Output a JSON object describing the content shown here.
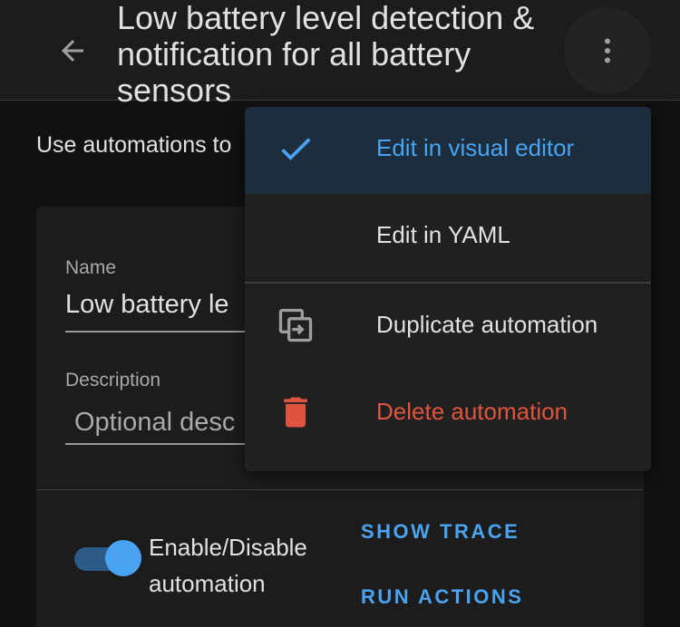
{
  "header": {
    "title": "Low battery level detection & notification for all battery sensors"
  },
  "intro_text": "Use automations to",
  "form": {
    "name_label": "Name",
    "name_value": "Low battery le",
    "description_label": "Description",
    "description_placeholder": "Optional desc"
  },
  "toggle": {
    "label": "Enable/Disable automation",
    "enabled": true
  },
  "actions": {
    "show_trace": "SHOW TRACE",
    "run_actions": "RUN ACTIONS"
  },
  "menu": {
    "items": [
      {
        "label": "Edit in visual editor",
        "icon": "check-icon",
        "selected": true,
        "color": "#4aa3f0"
      },
      {
        "label": "Edit in YAML",
        "icon": "",
        "selected": false,
        "color": "#e1e1e1"
      },
      {
        "label": "Duplicate automation",
        "icon": "duplicate-icon",
        "selected": false,
        "color": "#e1e1e1"
      },
      {
        "label": "Delete automation",
        "icon": "delete-icon",
        "selected": false,
        "color": "#e0533f"
      }
    ]
  },
  "colors": {
    "accent": "#4aa3f0",
    "danger": "#e0533f",
    "background": "#111111",
    "surface": "#1c1c1c"
  }
}
